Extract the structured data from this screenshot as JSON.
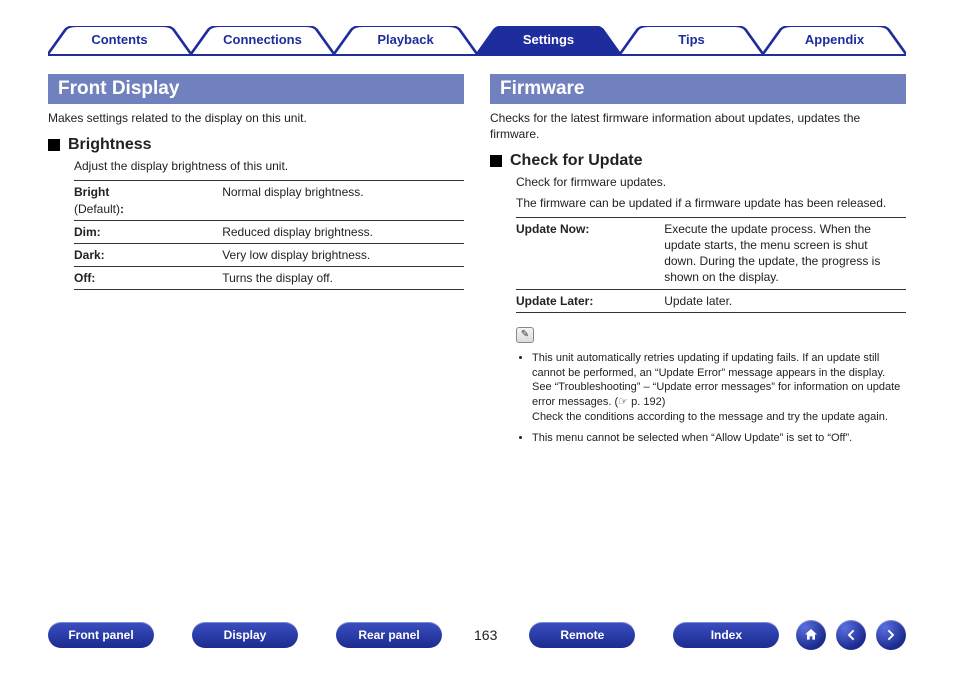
{
  "nav": {
    "tabs": [
      {
        "label": "Contents",
        "active": false
      },
      {
        "label": "Connections",
        "active": false
      },
      {
        "label": "Playback",
        "active": false
      },
      {
        "label": "Settings",
        "active": true
      },
      {
        "label": "Tips",
        "active": false
      },
      {
        "label": "Appendix",
        "active": false
      }
    ]
  },
  "left": {
    "title": "Front Display",
    "intro": "Makes settings related to the display on this unit.",
    "sub": {
      "title": "Brightness",
      "desc": "Adjust the display brightness of this unit.",
      "rows": [
        {
          "label_bold": "Bright",
          "label_light": "(Default)",
          "colon": ":",
          "val": "Normal display brightness."
        },
        {
          "label_bold": "Dim:",
          "label_light": "",
          "colon": "",
          "val": "Reduced display brightness."
        },
        {
          "label_bold": "Dark:",
          "label_light": "",
          "colon": "",
          "val": "Very low display brightness."
        },
        {
          "label_bold": "Off:",
          "label_light": "",
          "colon": "",
          "val": "Turns the display off."
        }
      ]
    }
  },
  "right": {
    "title": "Firmware",
    "intro": "Checks for the latest firmware information about updates, updates the firmware.",
    "sub": {
      "title": "Check for Update",
      "desc1": "Check for firmware updates.",
      "desc2": "The firmware can be updated if a firmware update has been released.",
      "rows": [
        {
          "label": "Update Now:",
          "val": "Execute the update process. When the update starts, the menu screen is shut down. During the update, the progress is shown on the display."
        },
        {
          "label": "Update Later:",
          "val": "Update later."
        }
      ]
    },
    "notes": [
      "This unit automatically retries updating if updating fails. If an update still cannot be performed, an “Update Error” message appears in the display. See “Troubleshooting” – “Update error messages” for information on update error messages. (☞ p. 192)\nCheck the conditions according to the message and try the update again.",
      "This menu cannot be selected when “Allow Update” is set to “Off”."
    ],
    "note_icon_glyph": "✎"
  },
  "footer": {
    "buttons": [
      "Front panel",
      "Display",
      "Rear panel"
    ],
    "page": "163",
    "buttons2": [
      "Remote",
      "Index"
    ]
  }
}
